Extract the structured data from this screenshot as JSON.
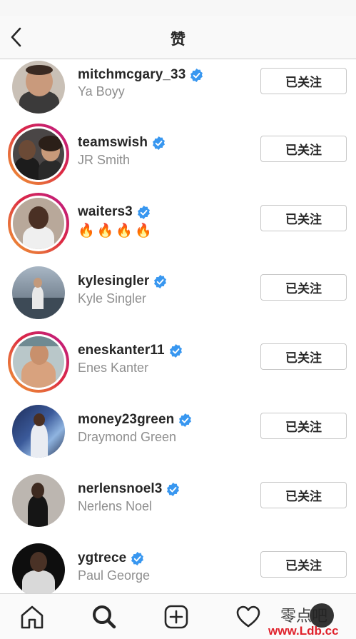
{
  "header": {
    "title": "赞",
    "back_icon": "chevron-left-icon"
  },
  "users": [
    {
      "username": "mitchmcgary_33",
      "subtitle": "Ya Boyy",
      "verified": true,
      "story": false,
      "follow_label": "已关注"
    },
    {
      "username": "teamswish",
      "subtitle": "JR Smith",
      "verified": true,
      "story": true,
      "follow_label": "已关注"
    },
    {
      "username": "waiters3",
      "subtitle": "🔥🔥🔥🔥",
      "verified": true,
      "story": true,
      "follow_label": "已关注"
    },
    {
      "username": "kylesingler",
      "subtitle": "Kyle Singler",
      "verified": true,
      "story": false,
      "follow_label": "已关注"
    },
    {
      "username": "eneskanter11",
      "subtitle": "Enes Kanter",
      "verified": true,
      "story": true,
      "follow_label": "已关注"
    },
    {
      "username": "money23green",
      "subtitle": "Draymond Green",
      "verified": true,
      "story": false,
      "follow_label": "已关注"
    },
    {
      "username": "nerlensnoel3",
      "subtitle": "Nerlens Noel",
      "verified": true,
      "story": false,
      "follow_label": "已关注"
    },
    {
      "username": "ygtrece",
      "subtitle": "Paul George",
      "verified": true,
      "story": false,
      "follow_label": "已关注"
    }
  ],
  "tabbar": {
    "items": [
      "home-icon",
      "search-icon",
      "add-post-icon",
      "heart-icon",
      "profile-avatar"
    ]
  },
  "watermark": {
    "text_cn": "零点吧",
    "url": "www.Ldb.cc"
  },
  "colors": {
    "verified_blue": "#3897f0",
    "story_ring_start": "#f09433",
    "story_ring_end": "#bc1888",
    "subtitle_gray": "#8e8e8e"
  }
}
